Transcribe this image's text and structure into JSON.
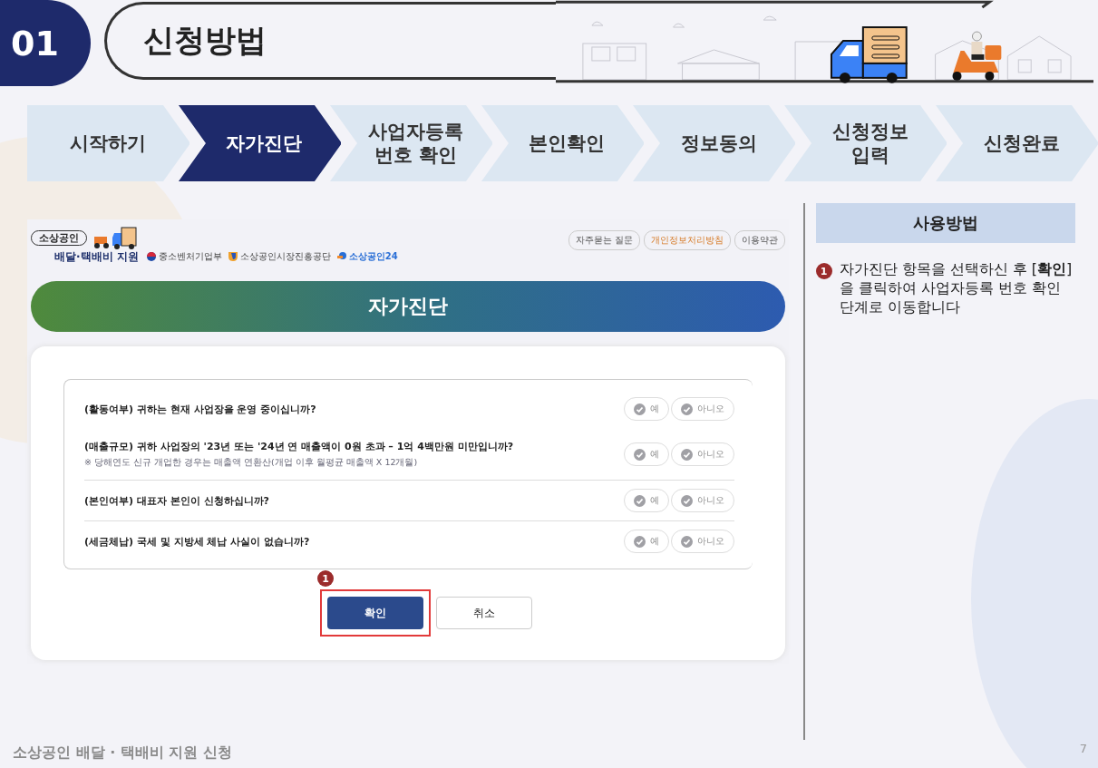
{
  "section": {
    "number": "01",
    "title": "신청방법"
  },
  "steps": [
    {
      "label": "시작하기",
      "selected": false
    },
    {
      "label": "자가진단",
      "selected": true
    },
    {
      "label": "사업자등록\n번호 확인",
      "selected": false
    },
    {
      "label": "본인확인",
      "selected": false
    },
    {
      "label": "정보동의",
      "selected": false
    },
    {
      "label": "신청정보\n입력",
      "selected": false
    },
    {
      "label": "신청완료",
      "selected": false
    }
  ],
  "screen": {
    "logo": {
      "badge": "소상공인",
      "title": "배달·택배비 지원"
    },
    "agencies": [
      "중소벤처기업부",
      "소상공인시장진흥공단",
      "소상공인24"
    ],
    "links": [
      {
        "label": "자주묻는 질문",
        "highlight": false
      },
      {
        "label": "개인정보처리방침",
        "highlight": true
      },
      {
        "label": "이용약관",
        "highlight": false
      }
    ],
    "banner": "자가진단",
    "questions": [
      {
        "text": "(활동여부) 귀하는 현재 사업장을 운영 중이십니까?",
        "options": [
          {
            "label": "예",
            "selected": false
          },
          {
            "label": "아니오",
            "selected": false
          }
        ]
      },
      {
        "text": "(매출규모) 귀하 사업장의 '23년 또는 '24년 연 매출액이 0원 초과 – 1억 4백만원 미만입니까?",
        "note": "※ 당해연도 신규 개업한 경우는 매출액 연환산(개업 이후 월평균 매출액 X 12개월)",
        "options": [
          {
            "label": "예",
            "selected": false
          },
          {
            "label": "아니오",
            "selected": false
          }
        ]
      },
      {
        "text": "(본인여부) 대표자 본인이 신청하십니까?",
        "options": [
          {
            "label": "예",
            "selected": false
          },
          {
            "label": "아니오",
            "selected": false
          }
        ]
      },
      {
        "text": "(세금체납) 국세 및 지방세 체납 사실이 없습니까?",
        "options": [
          {
            "label": "예",
            "selected": false
          },
          {
            "label": "아니오",
            "selected": false
          }
        ]
      }
    ],
    "buttons": [
      {
        "label": "확인",
        "kind": "primary",
        "marker": "1"
      },
      {
        "label": "취소",
        "kind": "secondary"
      }
    ]
  },
  "usage": {
    "title": "사용방법",
    "items": [
      {
        "marker": "1",
        "text": "자가진단 항목을 선택하신 후 [**확인**]을 클릭하여 사업자등록 번호 확인 단계로 이동합니다"
      }
    ]
  },
  "footer": {
    "title": "소상공인 배달 · 택배비 지원 신청",
    "page": "7"
  }
}
